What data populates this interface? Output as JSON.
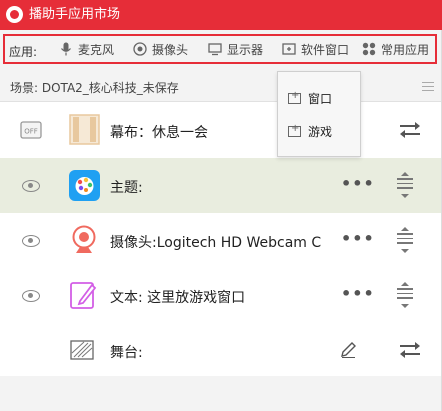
{
  "window": {
    "title": "播助手应用市场"
  },
  "appbar": {
    "label": "应用:",
    "items": [
      {
        "label": "麦克风",
        "icon": "microphone-icon"
      },
      {
        "label": "摄像头",
        "icon": "camera-icon"
      },
      {
        "label": "显示器",
        "icon": "monitor-icon"
      },
      {
        "label": "软件窗口",
        "icon": "window-icon"
      },
      {
        "label": "常用应用",
        "icon": "apps-grid-icon"
      }
    ]
  },
  "scene": {
    "label": "场景:",
    "name": "DOTA2_核心科技_未保存"
  },
  "popup": {
    "items": [
      {
        "label": "窗口",
        "icon": "window-add-icon"
      },
      {
        "label": "游戏",
        "icon": "game-add-icon"
      }
    ]
  },
  "layers": [
    {
      "label": "幕布：休息一会",
      "icon": "curtain-icon",
      "toggle": "OFF",
      "action": "swap"
    },
    {
      "label": "主题:",
      "icon": "theme-icon",
      "toggle": "eye",
      "action": "drag",
      "selected": true
    },
    {
      "label": "摄像头:Logitech HD Webcam C",
      "icon": "webcam-icon",
      "toggle": "eye",
      "action": "drag"
    },
    {
      "label": "文本: 这里放游戏窗口",
      "icon": "text-edit-icon",
      "toggle": "eye",
      "action": "drag"
    },
    {
      "label": "舞台:",
      "icon": "stage-icon",
      "toggle": "none",
      "action": "swap"
    }
  ],
  "more_label": "•••",
  "colors": {
    "accent": "#e62d38",
    "selected_row": "#e9eddf"
  }
}
